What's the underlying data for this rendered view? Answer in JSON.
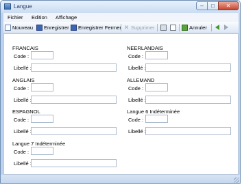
{
  "window": {
    "title": "Langue"
  },
  "menu": {
    "items": [
      "Fichier",
      "Edition",
      "Affichage"
    ]
  },
  "toolbar": {
    "new_label": "Nouveau",
    "save_label": "Enregistrer",
    "save_close_label": "Enregistrer Fermer",
    "delete_label": "Supprimer",
    "cancel_label": "Annuler"
  },
  "form": {
    "code_label": "Code :",
    "libelle_label": "Libellé :",
    "groups": [
      {
        "title": "FRANCAIS",
        "code": "",
        "libelle": ""
      },
      {
        "title": "NEERLANDAIS",
        "code": "",
        "libelle": ""
      },
      {
        "title": "ANGLAIS",
        "code": "",
        "libelle": ""
      },
      {
        "title": "ALLEMAND",
        "code": "",
        "libelle": ""
      },
      {
        "title": "ESPAGNOL",
        "code": "",
        "libelle": ""
      },
      {
        "title": "Langue 6 Indéterminée",
        "code": "",
        "libelle": ""
      },
      {
        "title": "Langue 7 Indéterminée",
        "code": "",
        "libelle": ""
      }
    ]
  },
  "icons": {
    "app": "window-app-icon",
    "new": "new-document-icon",
    "save": "save-disk-icon",
    "save_close": "save-close-icon",
    "delete": "delete-x-icon",
    "print": "printer-icon",
    "preview": "print-preview-icon",
    "cancel": "undo-icon",
    "back": "arrow-left-icon",
    "forward": "arrow-right-icon"
  }
}
